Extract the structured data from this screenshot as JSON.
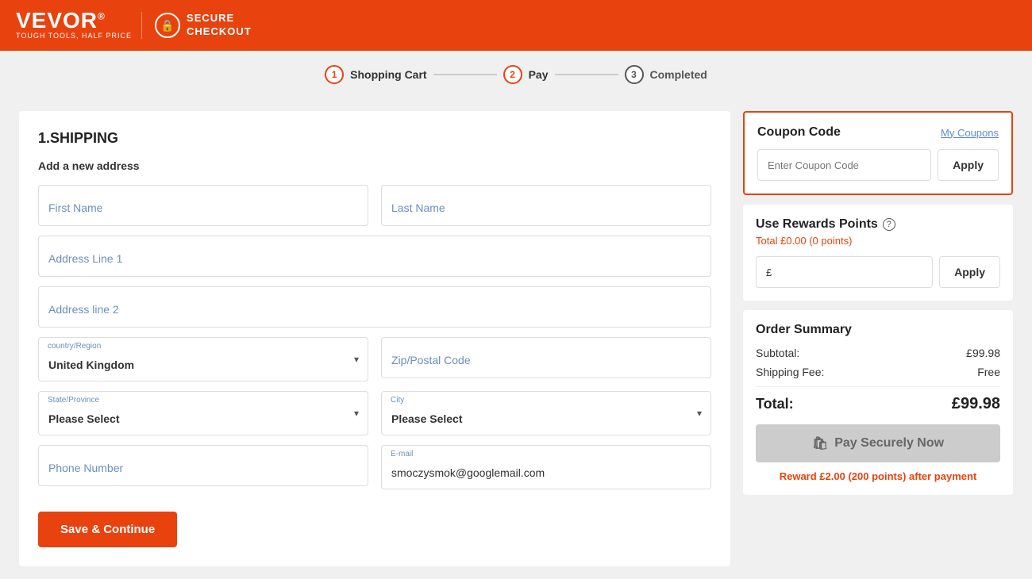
{
  "header": {
    "logo": "VEVOR",
    "logo_sup": "®",
    "logo_sub": "TOUGH TOOLS, HALF PRICE",
    "secure_label": "SECURE\nCHECKOUT"
  },
  "stepper": {
    "steps": [
      {
        "number": "1",
        "label": "Shopping Cart",
        "state": "active"
      },
      {
        "number": "2",
        "label": "Pay",
        "state": "active"
      },
      {
        "number": "3",
        "label": "Completed",
        "state": "inactive"
      }
    ]
  },
  "shipping": {
    "section_title": "1.SHIPPING",
    "subsection_title": "Add a new address",
    "fields": {
      "first_name_placeholder": "First Name",
      "last_name_placeholder": "Last Name",
      "address1_placeholder": "Address Line 1",
      "address2_placeholder": "Address line 2",
      "country_label": "country/Region",
      "country_value": "United Kingdom",
      "zip_placeholder": "Zip/Postal Code",
      "state_label": "State/Province",
      "state_value": "Please Select",
      "city_label": "City",
      "city_value": "Please Select",
      "phone_placeholder": "Phone Number",
      "email_label": "E-mail",
      "email_value": "smoczysmok@googlemail.com"
    },
    "save_button": "Save & Continue"
  },
  "coupon": {
    "title": "Coupon Code",
    "my_coupons_link": "My Coupons",
    "input_placeholder": "Enter Coupon Code",
    "apply_button": "Apply"
  },
  "rewards": {
    "title": "Use Rewards Points",
    "total_label": "Total £0.00 (0 points)",
    "input_prefix": "£",
    "apply_button": "Apply"
  },
  "order_summary": {
    "title": "Order Summary",
    "subtotal_label": "Subtotal:",
    "subtotal_value": "£99.98",
    "shipping_label": "Shipping Fee:",
    "shipping_value": "Free",
    "total_label": "Total:",
    "total_value": "£99.98",
    "pay_button": "Pay Securely Now",
    "reward_note_prefix": "Reward ",
    "reward_amount": "£2.00 (200 points)",
    "reward_note_suffix": " after payment"
  }
}
